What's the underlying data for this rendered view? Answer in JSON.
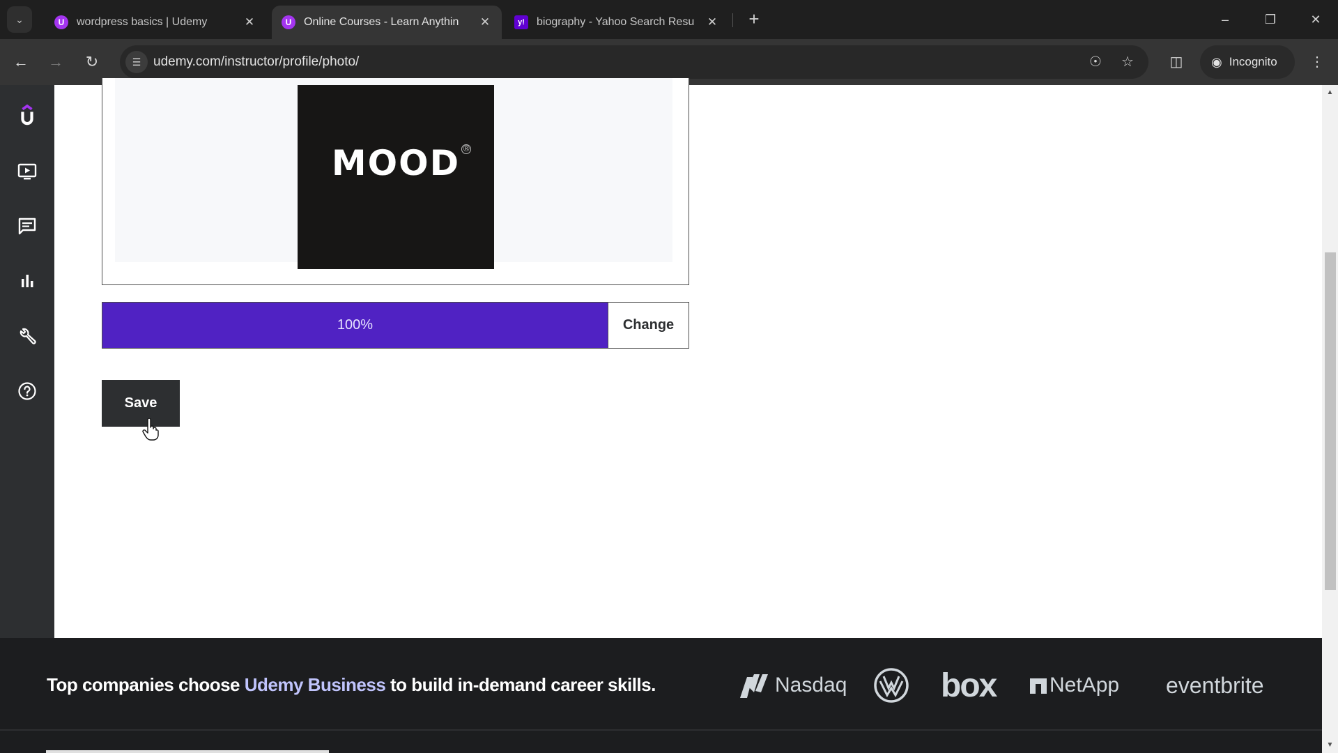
{
  "browser": {
    "tabs": [
      {
        "title": "wordpress basics | Udemy",
        "favicon": "udemy-icon",
        "active": false
      },
      {
        "title": "Online Courses - Learn Anythin",
        "favicon": "udemy-icon",
        "active": true
      },
      {
        "title": "biography - Yahoo Search Resu",
        "favicon": "yahoo-icon",
        "active": false
      }
    ],
    "url": "udemy.com/instructor/profile/photo/",
    "incognito_label": "Incognito",
    "window_controls": [
      "minimize",
      "restore",
      "close"
    ]
  },
  "sidebar": {
    "items": [
      {
        "name": "udemy-logo",
        "icon": "udemy-logo-icon"
      },
      {
        "name": "courses",
        "icon": "tv-play-icon"
      },
      {
        "name": "communication",
        "icon": "chat-icon"
      },
      {
        "name": "performance",
        "icon": "bar-chart-icon"
      },
      {
        "name": "tools",
        "icon": "wrench-icon"
      },
      {
        "name": "resources",
        "icon": "help-circle-icon"
      }
    ]
  },
  "photo_editor": {
    "image_text": "MOOD",
    "image_mark": "®",
    "upload_progress_percent": 100,
    "progress_label": "100%",
    "change_label": "Change",
    "save_label": "Save"
  },
  "footer": {
    "text_before": "Top companies choose ",
    "highlight": "Udemy Business",
    "text_after": " to build in-demand career skills.",
    "brands": [
      "Nasdaq",
      "Volkswagen",
      "box",
      "NetApp",
      "eventbrite"
    ]
  },
  "colors": {
    "accent_purple": "#5022c3",
    "udemy_purple": "#a435f0",
    "footer_bg": "#1c1d1f",
    "highlight_text": "#c0c4fc"
  }
}
